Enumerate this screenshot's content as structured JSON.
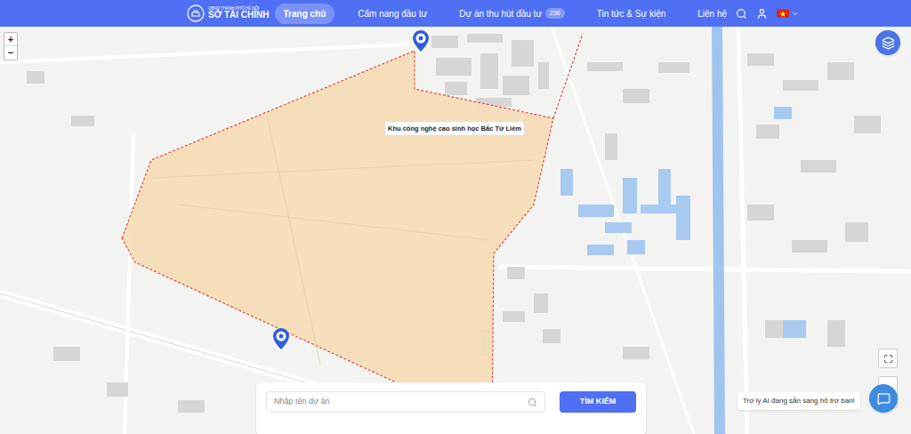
{
  "header": {
    "logo": {
      "subtitle": "UBND THÀNH PHỐ HÀ NỘI",
      "title": "SỞ TÀI CHÍNH"
    },
    "nav": [
      {
        "label": "Trang chủ",
        "selected": true,
        "badge": ""
      },
      {
        "label": "Cẩm nang đầu tư",
        "selected": false,
        "badge": ""
      },
      {
        "label": "Dự án thu hút đầu tư",
        "selected": false,
        "badge": "236"
      },
      {
        "label": "Tin tức & Sự kiện",
        "selected": false,
        "badge": ""
      },
      {
        "label": "Liên hệ",
        "selected": false,
        "badge": ""
      }
    ]
  },
  "map": {
    "zoom": [
      "+",
      "−"
    ],
    "region_label": "Khu công nghệ cao sinh học Bắc Từ Liêm"
  },
  "search": {
    "placeholder": "Nhập tên dự án",
    "button": "TÌM KIẾM"
  },
  "assistant": {
    "message": "Trợ lý AI đang sẵn sàng hỗ trợ bạn!"
  }
}
